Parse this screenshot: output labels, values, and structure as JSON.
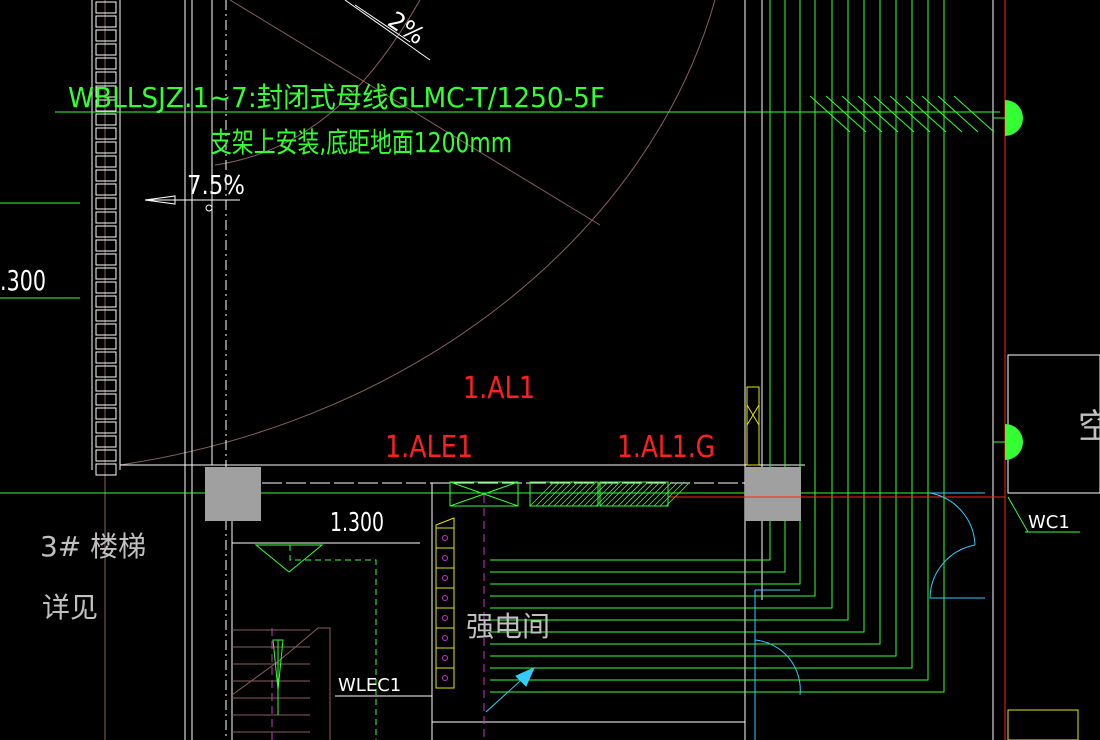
{
  "colors": {
    "background": "#000000",
    "green": "#33ff33",
    "white": "#ffffff",
    "red": "#ff2020",
    "dim_white": "#c0c0c0",
    "magenta": "#cc33cc",
    "cyan": "#33ccff",
    "yellow": "#e6e600",
    "olive": "#b0b070",
    "gray_block": "#a0a0a0",
    "brown": "#8a6060"
  },
  "annotations": {
    "busway_line1": "WBLLSJZ.1~7:封闭式母线GLMC-T/1250-5F",
    "busway_line2": "支架上安装,底距地面1200mm",
    "slope_top": "2%",
    "slope_left": "7.5%",
    "elev_left": ".300",
    "elev_mid": "1.300",
    "stair_label": "3# 楼梯",
    "stair_note": "详见",
    "room_label": "强电间",
    "panel_al1": "1.AL1",
    "panel_ale1": "1.ALE1",
    "panel_al1g": "1.AL1.G",
    "circuit_wc1": "WC1",
    "circuit_wlec1": "WLEC1",
    "room_right": "空"
  },
  "icons": {
    "bell_top": "wall-bell-icon",
    "bell_bottom": "wall-bell-icon",
    "breaker": "distribution-box-icon",
    "outlet": "outlet-column-icon"
  }
}
